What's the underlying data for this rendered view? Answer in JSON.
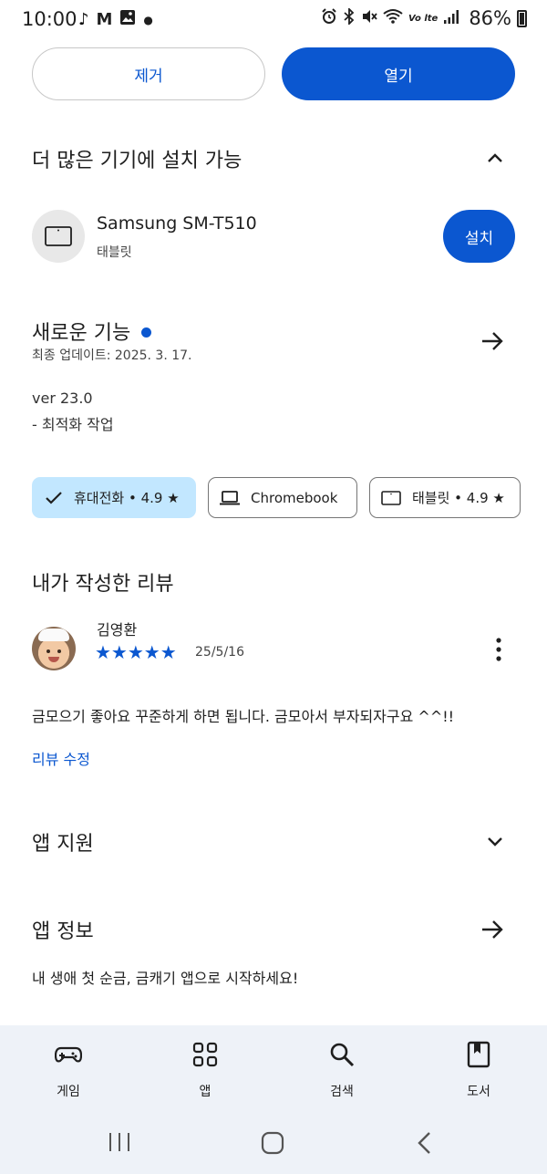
{
  "status_bar": {
    "time": "10:00",
    "left_icons": [
      "tiktok-icon",
      "gmail-icon",
      "gallery-icon",
      "dot-icon"
    ],
    "right_icons": [
      "alarm-icon",
      "bluetooth-icon",
      "mute-icon",
      "wifi-icon",
      "volte-icon",
      "signal-icon"
    ],
    "volte_label": "Vo lte",
    "battery": "86%"
  },
  "actions": {
    "remove_label": "제거",
    "open_label": "열기"
  },
  "more_devices": {
    "title": "더 많은 기기에 설치 가능",
    "device": {
      "name": "Samsung SM-T510",
      "type": "태블릿",
      "install_label": "설치"
    }
  },
  "whats_new": {
    "title": "새로운 기능",
    "updated": "최종 업데이트: 2025. 3. 17.",
    "version": "ver 23.0",
    "note": "- 최적화 작업"
  },
  "rating_chips": [
    {
      "label": "휴대전화 • 4.9 ★",
      "selected": true
    },
    {
      "label": "Chromebook",
      "selected": false
    },
    {
      "label": "태블릿 • 4.9 ★",
      "selected": false
    }
  ],
  "my_review": {
    "title": "내가 작성한 리뷰",
    "author": "김영환",
    "stars": 5,
    "star_glyphs": "★★★★★",
    "date": "25/5/16",
    "text": "금모으기 좋아요 꾸준하게 하면 됩니다. 금모아서 부자되자구요 ^^!!",
    "edit_label": "리뷰 수정"
  },
  "app_support": {
    "title": "앱 지원"
  },
  "app_info": {
    "title": "앱 정보",
    "description": "내 생애 첫 순금, 금캐기 앱으로 시작하세요!"
  },
  "bottom_nav": [
    {
      "label": "게임",
      "icon": "gamepad-icon"
    },
    {
      "label": "앱",
      "icon": "apps-grid-icon"
    },
    {
      "label": "검색",
      "icon": "search-icon"
    },
    {
      "label": "도서",
      "icon": "book-icon"
    }
  ],
  "colors": {
    "accent": "#0b57d0",
    "chip_selected": "#c2e7ff",
    "nav_bg": "#eef2f8"
  }
}
